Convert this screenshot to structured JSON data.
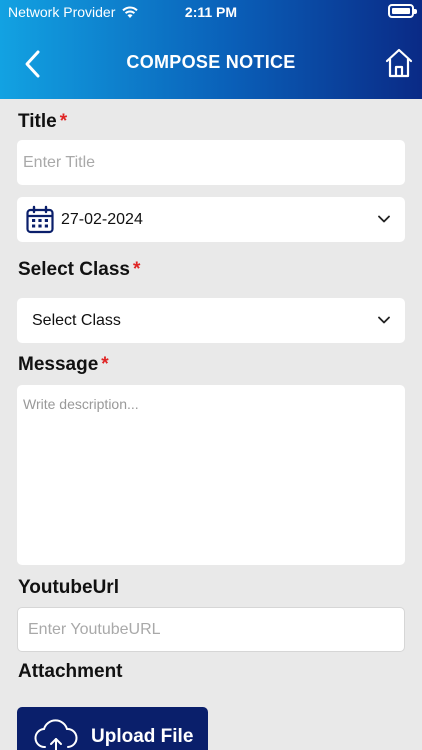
{
  "status_bar": {
    "carrier": "Network Provider",
    "time": "2:11 PM"
  },
  "header": {
    "title": "COMPOSE NOTICE"
  },
  "form": {
    "title_label": "Title",
    "title_required": "*",
    "title_placeholder": "Enter Title",
    "date_value": "27-02-2024",
    "class_label": "Select Class",
    "class_required": "*",
    "class_value": "Select Class",
    "message_label": "Message",
    "message_required": "*",
    "message_placeholder": "Write description...",
    "youtube_label": "YoutubeUrl",
    "youtube_placeholder": "Enter YoutubeURL",
    "attachment_label": "Attachment",
    "upload_label": "Upload File"
  },
  "icons": {
    "back": "chevron-left-icon",
    "home": "home-icon",
    "calendar": "calendar-icon",
    "dropdown": "chevron-down-icon",
    "upload": "cloud-upload-icon",
    "wifi": "wifi-icon",
    "battery": "battery-icon"
  },
  "colors": {
    "header_gradient": [
      "#12a2e2",
      "#0a5fb8",
      "#0a2a86"
    ],
    "required": "#e02424",
    "upload_button": "#0a1f6b",
    "background": "#e9e9e9"
  }
}
